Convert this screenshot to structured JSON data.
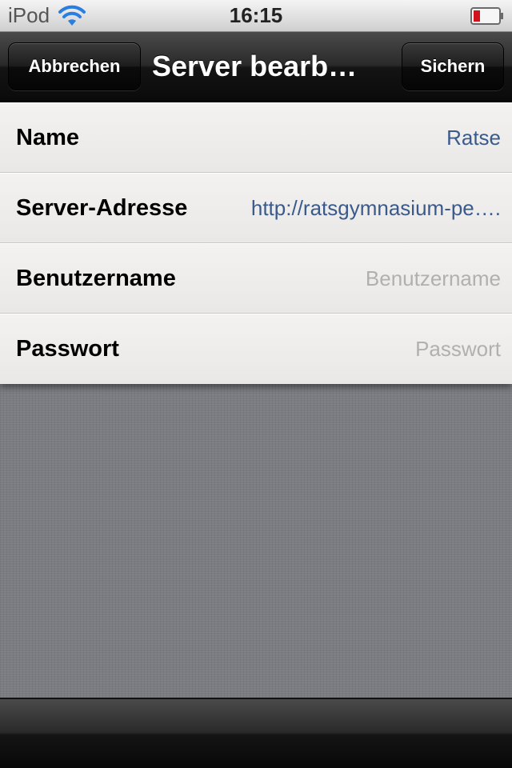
{
  "status_bar": {
    "device": "iPod",
    "time": "16:15",
    "icons": [
      "wifi-icon",
      "battery-low-icon"
    ],
    "battery_color": "#d0141e"
  },
  "nav_bar": {
    "cancel_label": "Abbrechen",
    "title": "Server bearb…",
    "save_label": "Sichern"
  },
  "form": {
    "name": {
      "label": "Name",
      "value": "Ratse"
    },
    "server_address": {
      "label": "Server-Adresse",
      "value": "http://ratsgymnasium-pe…."
    },
    "username": {
      "label": "Benutzername",
      "value": "",
      "placeholder": "Benutzername"
    },
    "password": {
      "label": "Passwort",
      "value": "",
      "placeholder": "Passwort"
    }
  },
  "colors": {
    "value_text": "#3a5a8c",
    "placeholder_text": "#b0b0b0",
    "linen_background": "#7a7c82"
  }
}
